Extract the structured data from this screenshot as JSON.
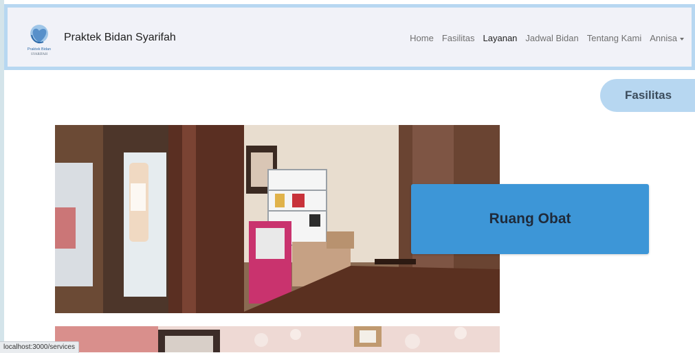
{
  "brand": {
    "name": "Praktek Bidan Syarifah",
    "logo_line1": "Praktek Bidan",
    "logo_line2": "SYARIFAH"
  },
  "nav": {
    "items": [
      {
        "label": "Home",
        "active": false
      },
      {
        "label": "Fasilitas",
        "active": false
      },
      {
        "label": "Layanan",
        "active": true
      },
      {
        "label": "Jadwal Bidan",
        "active": false
      },
      {
        "label": "Tentang Kami",
        "active": false
      }
    ],
    "user_menu": "Annisa"
  },
  "section": {
    "title": "Fasilitas"
  },
  "facilities": [
    {
      "label": "Ruang Obat"
    }
  ],
  "status_bar": {
    "url": "localhost:3000/services"
  },
  "colors": {
    "navbar_bg": "#f1f2f8",
    "navbar_border": "#b7d7f1",
    "pill_bg": "#b7d7f1",
    "card_bg": "#3d96d7"
  }
}
